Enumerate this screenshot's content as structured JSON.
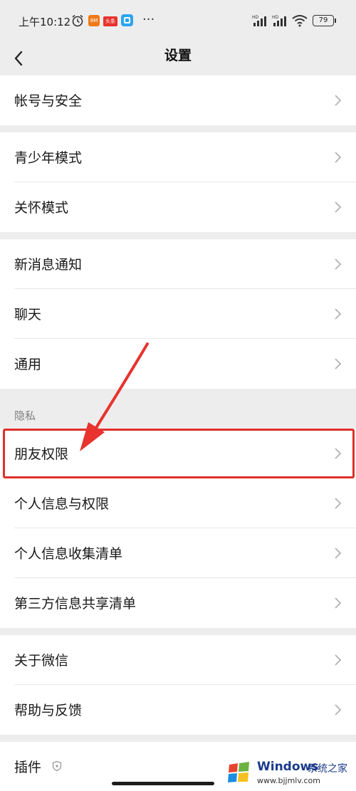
{
  "status_bar": {
    "time": "上午10:12",
    "app_badge_1": "8M",
    "app_badge_2": "头条",
    "more_dots": "···",
    "battery": "79",
    "hd_label": "HD"
  },
  "nav": {
    "title": "设置"
  },
  "groups": [
    {
      "items": [
        {
          "label": "帐号与安全"
        }
      ]
    },
    {
      "items": [
        {
          "label": "青少年模式"
        },
        {
          "label": "关怀模式"
        }
      ]
    },
    {
      "items": [
        {
          "label": "新消息通知"
        },
        {
          "label": "聊天"
        },
        {
          "label": "通用"
        }
      ]
    },
    {
      "header": "隐私",
      "items": [
        {
          "label": "朋友权限"
        },
        {
          "label": "个人信息与权限"
        },
        {
          "label": "个人信息收集清单"
        },
        {
          "label": "第三方信息共享清单"
        }
      ]
    },
    {
      "items": [
        {
          "label": "关于微信"
        },
        {
          "label": "帮助与反馈"
        }
      ]
    },
    {
      "items": [
        {
          "label": "插件"
        }
      ]
    }
  ],
  "annotation": {
    "highlight_color": "#e0302a",
    "highlighted_item": "朋友权限"
  },
  "watermark": {
    "title": "Windows",
    "subtitle": "系统之家",
    "url": "www.bjjmlv.com"
  },
  "colors": {
    "background": "#ededed",
    "row": "#ffffff",
    "text": "#191919",
    "chevron": "#b2b2b2"
  }
}
